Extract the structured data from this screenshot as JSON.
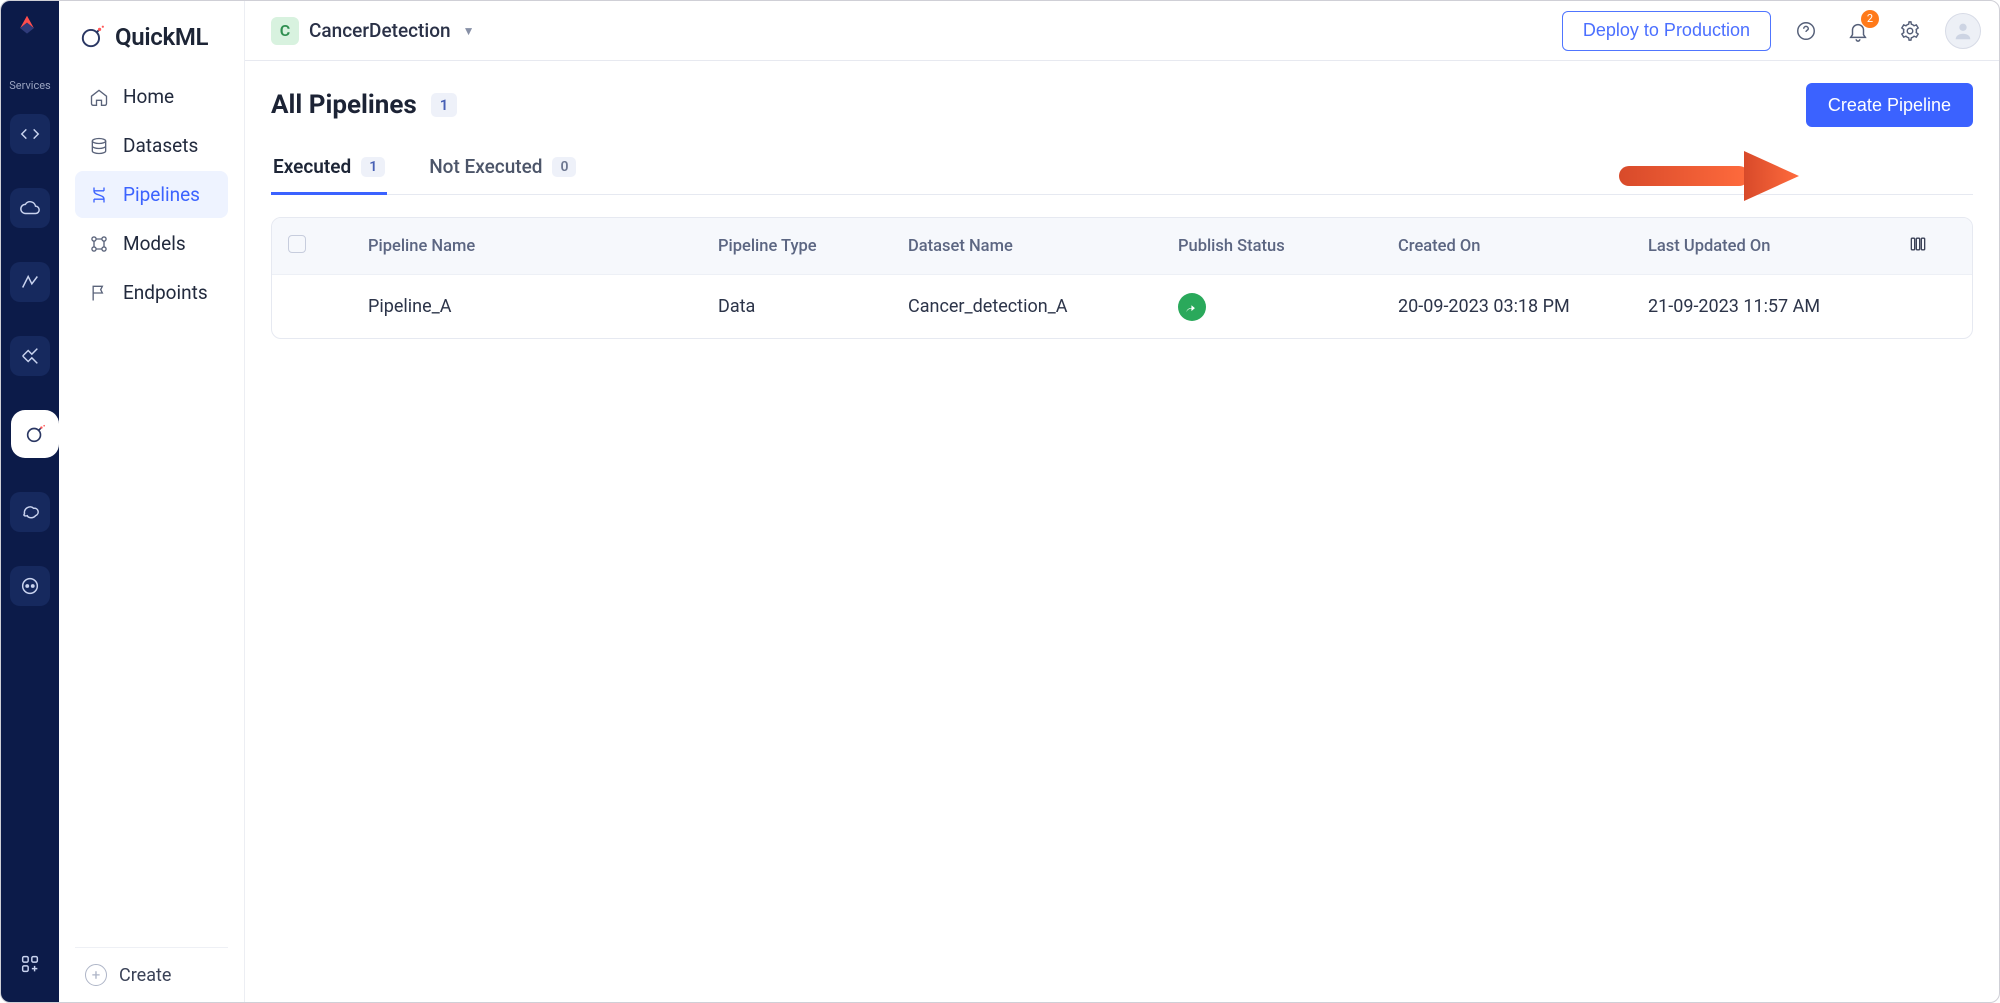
{
  "rail": {
    "services_label": "Services"
  },
  "topbar": {
    "project_initial": "C",
    "project_name": "CancerDetection",
    "deploy_label": "Deploy to Production",
    "notification_count": "2"
  },
  "sidebar": {
    "brand": "QuickML",
    "items": [
      {
        "label": "Home"
      },
      {
        "label": "Datasets"
      },
      {
        "label": "Pipelines"
      },
      {
        "label": "Models"
      },
      {
        "label": "Endpoints"
      }
    ],
    "create_label": "Create"
  },
  "page": {
    "title": "All Pipelines",
    "total_count": "1",
    "create_button": "Create Pipeline"
  },
  "tabs": [
    {
      "label": "Executed",
      "count": "1"
    },
    {
      "label": "Not Executed",
      "count": "0"
    }
  ],
  "table": {
    "headers": {
      "name": "Pipeline Name",
      "type": "Pipeline Type",
      "dataset": "Dataset Name",
      "status": "Publish Status",
      "created": "Created On",
      "updated": "Last Updated On"
    },
    "rows": [
      {
        "name": "Pipeline_A",
        "type": "Data",
        "dataset": "Cancer_detection_A",
        "created": "20-09-2023 03:18 PM",
        "updated": "21-09-2023 11:57 AM"
      }
    ]
  }
}
